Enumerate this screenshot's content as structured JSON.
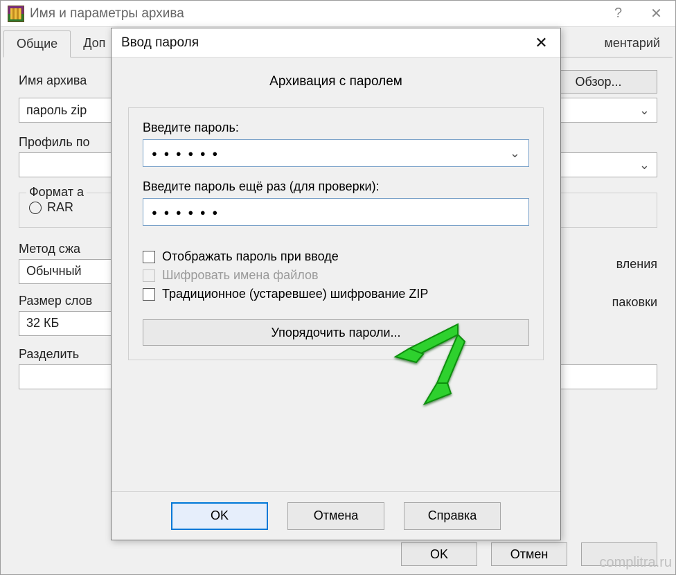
{
  "parent": {
    "title": "Имя и параметры архива",
    "help_symbol": "?",
    "close_symbol": "✕",
    "tabs": {
      "active": "Общие",
      "second_prefix": "Доп",
      "comment_suffix": "ментарий"
    },
    "archive_name_label": "Имя архива",
    "archive_name_value": "пароль zip",
    "browse_btn": "Обзор...",
    "profile_label": "Профиль по",
    "format_group": "Формат а",
    "radio_rar": "RAR",
    "compress_method_label": "Метод сжа",
    "compress_method_value": "Обычный",
    "dict_size_label": "Размер слов",
    "dict_size_value": "32 КБ",
    "split_label": "Разделить",
    "partial_update": "вления",
    "partial_pack": "паковки",
    "footer": {
      "ok": "OK",
      "cancel": "Отмен"
    }
  },
  "dialog": {
    "title": "Ввод пароля",
    "close_symbol": "✕",
    "heading": "Архивация с паролем",
    "password_label": "Введите пароль:",
    "password_dots": "● ● ● ● ● ●",
    "confirm_label": "Введите пароль ещё раз (для проверки):",
    "confirm_dots": "● ● ● ● ● ●",
    "chevron": "⌄",
    "show_password": "Отображать пароль при вводе",
    "encrypt_names": "Шифровать имена файлов",
    "legacy_zip": "Традиционное (устаревшее) шифрование ZIP",
    "organize_btn": "Упорядочить пароли...",
    "footer": {
      "ok": "OK",
      "cancel": "Отмена",
      "help": "Справка"
    }
  },
  "watermark": "complitra.ru"
}
